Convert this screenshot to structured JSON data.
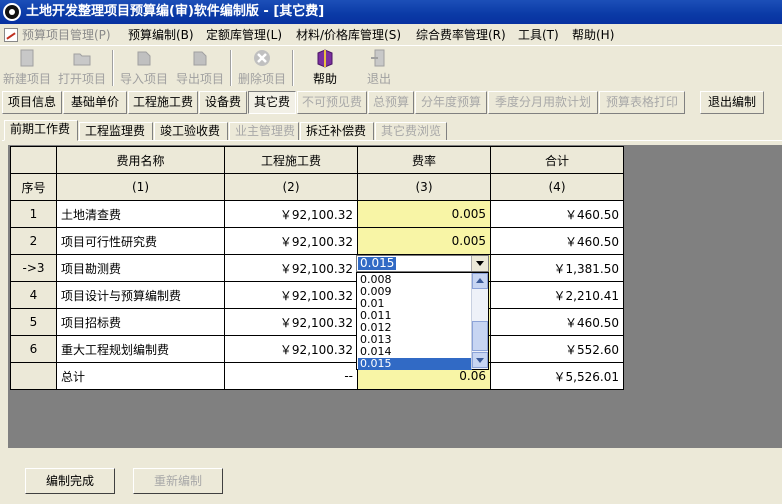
{
  "window": {
    "title": "土地开发整理项目预算编(审)软件编制版 - [其它费]"
  },
  "menubar": [
    {
      "label": "预算项目管理(P)",
      "disabled": true
    },
    {
      "label": "预算编制(B)",
      "disabled": false
    },
    {
      "label": "定额库管理(L)",
      "disabled": false
    },
    {
      "label": "材料/价格库管理(S)",
      "disabled": false
    },
    {
      "label": "综合费率管理(R)",
      "disabled": false
    },
    {
      "label": "工具(T)",
      "disabled": false
    },
    {
      "label": "帮助(H)",
      "disabled": false
    }
  ],
  "toolbar": [
    {
      "label": "新建项目",
      "icon": "new-project-icon"
    },
    {
      "label": "打开项目",
      "icon": "open-folder-icon"
    },
    {
      "label": "导入项目",
      "icon": "import-icon"
    },
    {
      "label": "导出项目",
      "icon": "export-icon"
    },
    {
      "label": "删除项目",
      "icon": "delete-icon"
    },
    {
      "label": "帮助",
      "icon": "help-book-icon"
    },
    {
      "label": "退出",
      "icon": "exit-icon"
    }
  ],
  "module_buttons": [
    "项目信息",
    "基础单价",
    "工程施工费",
    "设备费",
    "其它费",
    "不可预见费",
    "总预算",
    "分年度预算",
    "季度分月用款计划",
    "预算表格打印",
    "退出编制"
  ],
  "tabs": [
    "前期工作费",
    "工程监理费",
    "竣工验收费",
    "业主管理费",
    "拆迁补偿费",
    "其它费浏览"
  ],
  "grid": {
    "headers": [
      "费用名称",
      "工程施工费",
      "费率",
      "合计"
    ],
    "row_header_label": "序号",
    "col_numbers": [
      "(1)",
      "(2)",
      "(3)",
      "(4)"
    ],
    "rows": [
      {
        "no": "1",
        "name": "土地清查费",
        "cost": "￥92,100.32",
        "rate": "0.005",
        "total": "￥460.50"
      },
      {
        "no": "2",
        "name": "项目可行性研究费",
        "cost": "￥92,100.32",
        "rate": "0.005",
        "total": "￥460.50"
      },
      {
        "no": "->3",
        "name": "项目勘测费",
        "cost": "￥92,100.32",
        "rate": "",
        "total": "￥1,381.50"
      },
      {
        "no": "4",
        "name": "项目设计与预算编制费",
        "cost": "￥92,100.32",
        "rate": "",
        "total": "￥2,210.41"
      },
      {
        "no": "5",
        "name": "项目招标费",
        "cost": "￥92,100.32",
        "rate": "",
        "total": "￥460.50"
      },
      {
        "no": "6",
        "name": "重大工程规划编制费",
        "cost": "￥92,100.32",
        "rate": "",
        "total": "￥552.60"
      },
      {
        "no": "",
        "name": "总计",
        "cost": "--",
        "rate": "0.06",
        "total": "￥5,526.01"
      }
    ]
  },
  "rate_combo": {
    "value": "0.015",
    "options": [
      "0.008",
      "0.009",
      "0.01",
      "0.011",
      "0.012",
      "0.013",
      "0.014",
      "0.015"
    ],
    "selected_option": "0.015"
  },
  "bottom_buttons": [
    {
      "label": "编制完成",
      "disabled": false
    },
    {
      "label": "重新编制",
      "disabled": true
    }
  ]
}
